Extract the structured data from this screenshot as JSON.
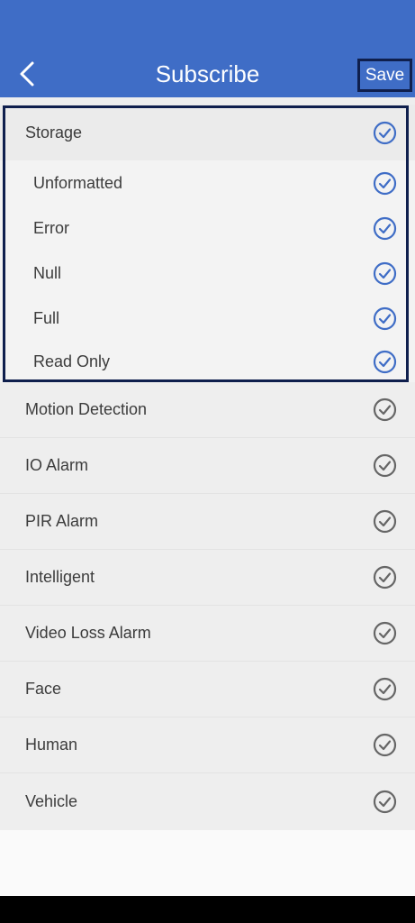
{
  "header": {
    "title": "Subscribe",
    "save_label": "Save",
    "back_icon": "chevron-left-icon",
    "background_color": "#3f6dc6"
  },
  "storage": {
    "label": "Storage",
    "checked": true,
    "accent_color": "#3f6dc6",
    "sub_items": [
      {
        "label": "Unformatted",
        "checked": true
      },
      {
        "label": "Error",
        "checked": true
      },
      {
        "label": "Null",
        "checked": true
      },
      {
        "label": "Full",
        "checked": true
      },
      {
        "label": "Read Only",
        "checked": true
      }
    ]
  },
  "categories": [
    {
      "label": "Motion Detection",
      "checked": false
    },
    {
      "label": "IO Alarm",
      "checked": false
    },
    {
      "label": "PIR Alarm",
      "checked": false
    },
    {
      "label": "Intelligent",
      "checked": false
    },
    {
      "label": "Video Loss Alarm",
      "checked": false
    },
    {
      "label": "Face",
      "checked": false
    },
    {
      "label": "Human",
      "checked": false
    },
    {
      "label": "Vehicle",
      "checked": false
    }
  ],
  "check_icon": "check-circle-icon",
  "unchecked_color": "#666666"
}
